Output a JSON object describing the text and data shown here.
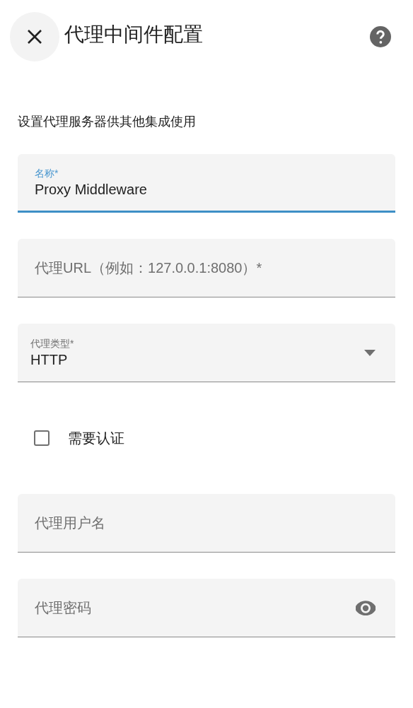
{
  "dialog": {
    "title": "代理中间件配置",
    "description": "设置代理服务器供其他集成使用"
  },
  "fields": [
    {
      "kind": "text",
      "label": "名称*",
      "value": "Proxy Middleware",
      "focused": true
    },
    {
      "kind": "text",
      "placeholder": "代理URL（例如：127.0.0.1:8080）*",
      "focused": false
    },
    {
      "kind": "select",
      "label": "代理类型*",
      "value": "HTTP",
      "focused": false
    },
    {
      "kind": "checkbox",
      "label": "需要认证",
      "checked": false
    },
    {
      "kind": "text",
      "placeholder": "代理用户名",
      "focused": false
    },
    {
      "kind": "password",
      "placeholder": "代理密码",
      "focused": false
    }
  ]
}
